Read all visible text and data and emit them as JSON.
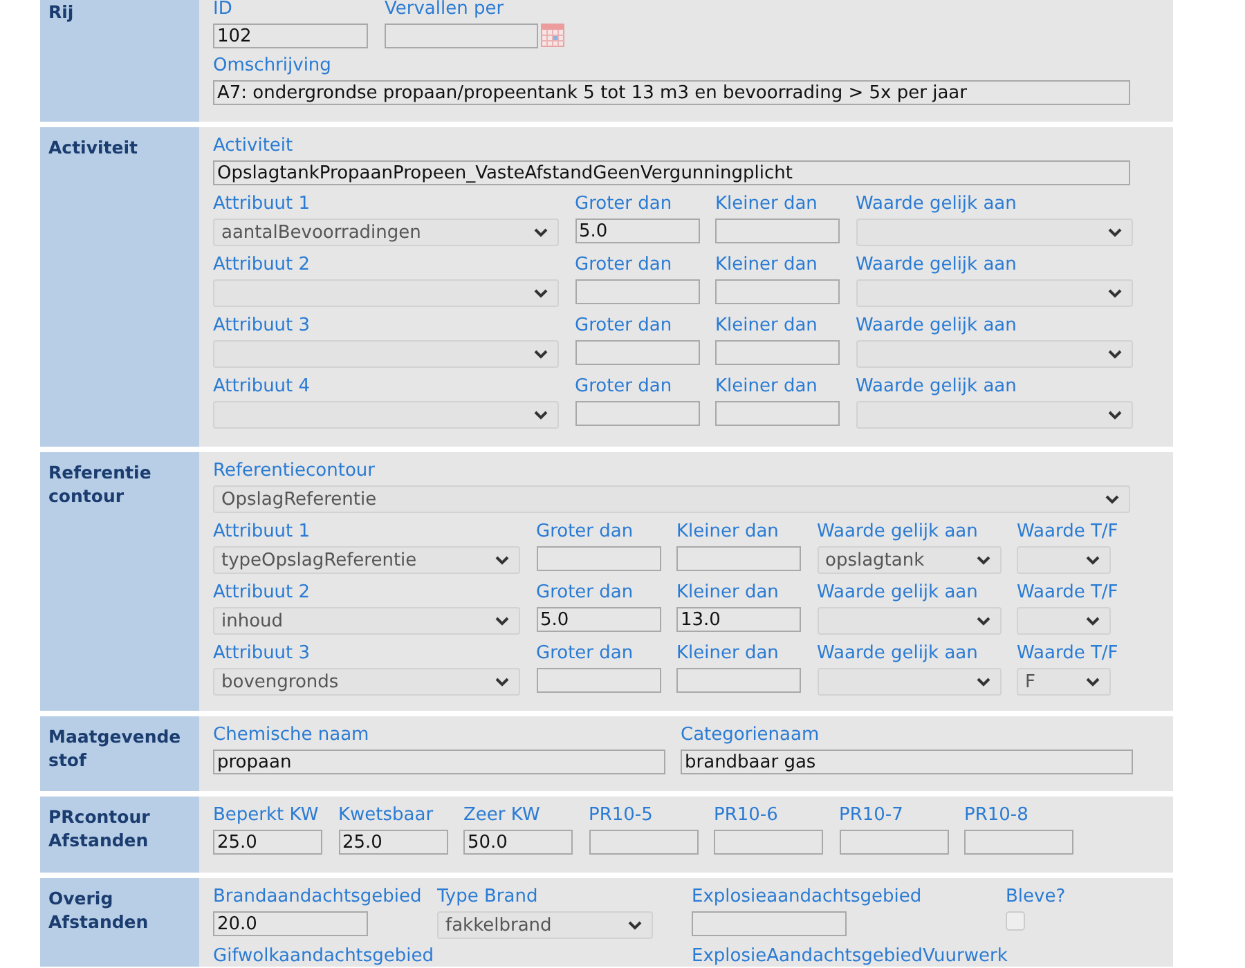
{
  "rij": {
    "heading": "Rij",
    "id": {
      "label": "ID",
      "value": "102"
    },
    "vervallen_per": {
      "label": "Vervallen per"
    },
    "omschrijving": {
      "label": "Omschrijving",
      "value": "A7: ondergrondse propaan/propeentank 5 tot 13 m3 en bevoorrading > 5x per jaar"
    }
  },
  "activiteit": {
    "heading": "Activiteit",
    "activiteit": {
      "label": "Activiteit",
      "value": "OpslagtankPropaanPropeen_VasteAfstandGeenVergunningplicht"
    },
    "attributen": [
      {
        "attribuut": {
          "label": "Attribuut 1",
          "value": "aantalBevoorradingen"
        },
        "groter_dan": {
          "label": "Groter dan",
          "value": "5.0"
        },
        "kleiner_dan": {
          "label": "Kleiner dan"
        },
        "waarde_gelijk_aan": {
          "label": "Waarde gelijk aan"
        }
      },
      {
        "attribuut": {
          "label": "Attribuut 2"
        },
        "groter_dan": {
          "label": "Groter dan"
        },
        "kleiner_dan": {
          "label": "Kleiner dan"
        },
        "waarde_gelijk_aan": {
          "label": "Waarde gelijk aan"
        }
      },
      {
        "attribuut": {
          "label": "Attribuut 3"
        },
        "groter_dan": {
          "label": "Groter dan"
        },
        "kleiner_dan": {
          "label": "Kleiner dan"
        },
        "waarde_gelijk_aan": {
          "label": "Waarde gelijk aan"
        }
      },
      {
        "attribuut": {
          "label": "Attribuut 4"
        },
        "groter_dan": {
          "label": "Groter dan"
        },
        "kleiner_dan": {
          "label": "Kleiner dan"
        },
        "waarde_gelijk_aan": {
          "label": "Waarde gelijk aan"
        }
      }
    ]
  },
  "referentie_contour": {
    "heading": "Referentie contour",
    "referentiecontour": {
      "label": "Referentiecontour",
      "value": "OpslagReferentie"
    },
    "attributen": [
      {
        "attribuut": {
          "label": "Attribuut 1",
          "value": "typeOpslagReferentie"
        },
        "groter_dan": {
          "label": "Groter dan"
        },
        "kleiner_dan": {
          "label": "Kleiner dan"
        },
        "waarde_gelijk_aan": {
          "label": "Waarde gelijk aan",
          "value": "opslagtank"
        },
        "waarde_tf": {
          "label": "Waarde T/F"
        }
      },
      {
        "attribuut": {
          "label": "Attribuut 2",
          "value": "inhoud"
        },
        "groter_dan": {
          "label": "Groter dan",
          "value": "5.0"
        },
        "kleiner_dan": {
          "label": "Kleiner dan",
          "value": "13.0"
        },
        "waarde_gelijk_aan": {
          "label": "Waarde gelijk aan"
        },
        "waarde_tf": {
          "label": "Waarde T/F"
        }
      },
      {
        "attribuut": {
          "label": "Attribuut 3",
          "value": "bovengronds"
        },
        "groter_dan": {
          "label": "Groter dan"
        },
        "kleiner_dan": {
          "label": "Kleiner dan"
        },
        "waarde_gelijk_aan": {
          "label": "Waarde gelijk aan"
        },
        "waarde_tf": {
          "label": "Waarde T/F",
          "value": "F"
        }
      }
    ]
  },
  "maatgevende_stof": {
    "heading": "Maatgevende stof",
    "chemische_naam": {
      "label": "Chemische naam",
      "value": "propaan"
    },
    "categorienaam": {
      "label": "Categorienaam",
      "value": "brandbaar gas"
    }
  },
  "prcontour_afstanden": {
    "heading": "PRcontour Afstanden",
    "fields": [
      {
        "label": "Beperkt KW",
        "value": "25.0"
      },
      {
        "label": "Kwetsbaar",
        "value": "25.0"
      },
      {
        "label": "Zeer KW",
        "value": "50.0"
      },
      {
        "label": "PR10-5"
      },
      {
        "label": "PR10-6"
      },
      {
        "label": "PR10-7"
      },
      {
        "label": "PR10-8"
      }
    ]
  },
  "overig_afstanden": {
    "heading": "Overig Afstanden",
    "brandaandachtsgebied": {
      "label": "Brandaandachtsgebied",
      "value": "20.0"
    },
    "type_brand": {
      "label": "Type Brand",
      "value": "fakkelbrand"
    },
    "explosieaandachtsgebied": {
      "label": "Explosieaandachtsgebied"
    },
    "bleve": {
      "label": "Bleve?",
      "checked": false
    },
    "gifwolkaandachtsgebied": {
      "label": "Gifwolkaandachtsgebied"
    },
    "explosieaandachtsgebied_vuurwerk": {
      "label": "ExplosieAandachtsgebiedVuurwerk"
    }
  }
}
